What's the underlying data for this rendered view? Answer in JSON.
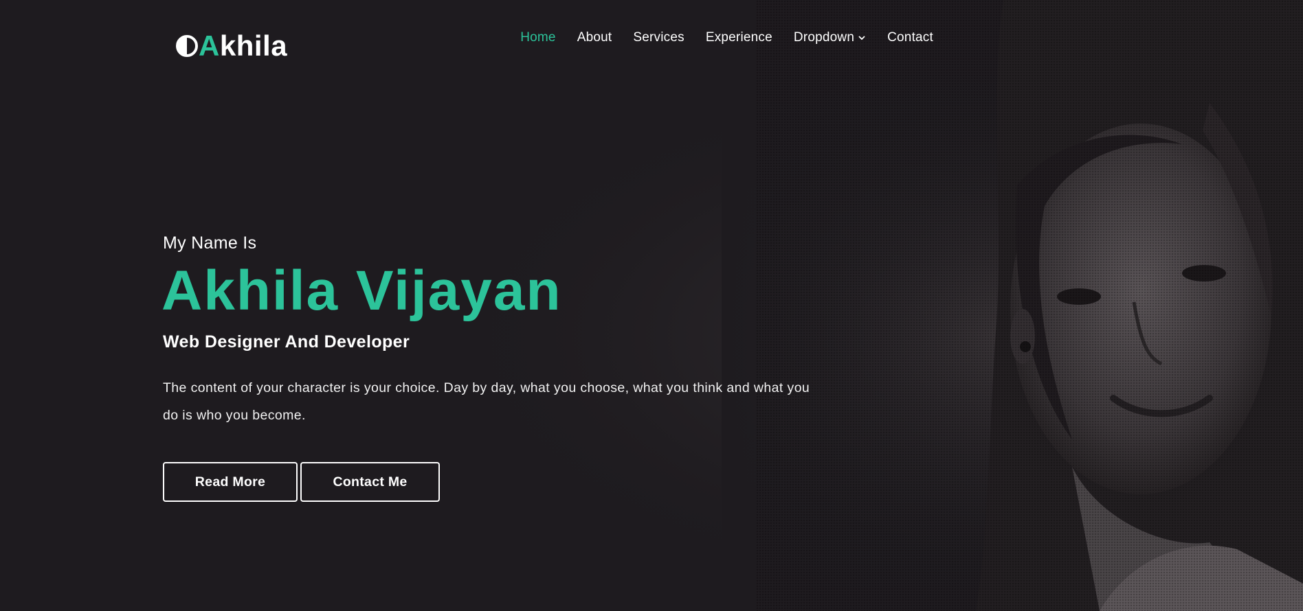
{
  "brand": {
    "icon": "half-circle-logo-icon",
    "accent_letter": "A",
    "rest": "khila",
    "accent_color": "#2cc39a"
  },
  "nav": {
    "items": [
      {
        "label": "Home",
        "active": true
      },
      {
        "label": "About"
      },
      {
        "label": "Services"
      },
      {
        "label": "Experience"
      },
      {
        "label": "Dropdown",
        "icon": "chevron-down-icon"
      },
      {
        "label": "Contact"
      }
    ]
  },
  "hero": {
    "intro": "My Name Is",
    "name": "Akhila Vijayan",
    "role": "Web Designer And Developer",
    "description": "The content of your character is your choice. Day by day, what you choose, what you think and what you do is who you become.",
    "buttons": {
      "read_more": "Read More",
      "contact_me": "Contact Me"
    }
  },
  "colors": {
    "background": "#1e1b1f",
    "accent": "#2cc39a",
    "text": "#ffffff"
  }
}
